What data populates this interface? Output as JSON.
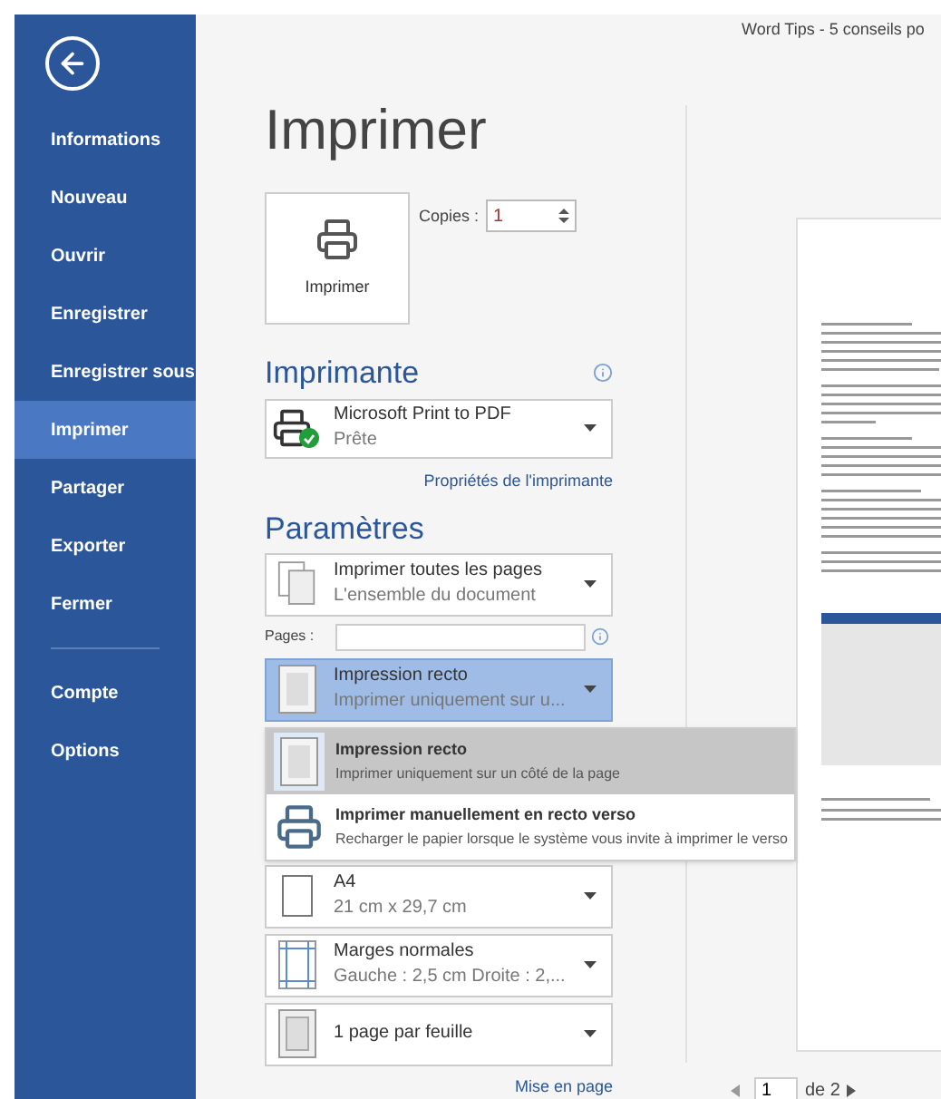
{
  "window": {
    "title": "Word Tips - 5 conseils po"
  },
  "sidebar": {
    "items": [
      {
        "label": "Informations",
        "selected": false
      },
      {
        "label": "Nouveau",
        "selected": false
      },
      {
        "label": "Ouvrir",
        "selected": false
      },
      {
        "label": "Enregistrer",
        "selected": false
      },
      {
        "label": "Enregistrer sous",
        "selected": false
      },
      {
        "label": "Imprimer",
        "selected": true
      },
      {
        "label": "Partager",
        "selected": false
      },
      {
        "label": "Exporter",
        "selected": false
      },
      {
        "label": "Fermer",
        "selected": false
      }
    ],
    "bottom_items": [
      {
        "label": "Compte",
        "selected": false
      },
      {
        "label": "Options",
        "selected": false
      }
    ]
  },
  "page_title": "Imprimer",
  "print_button": {
    "label": "Imprimer"
  },
  "copies": {
    "label": "Copies :",
    "value": "1"
  },
  "printer": {
    "heading": "Imprimante",
    "name": "Microsoft Print to PDF",
    "status": "Prête",
    "properties_link": "Propriétés de l'imprimante"
  },
  "settings": {
    "heading": "Paramètres",
    "pages_label": "Pages :",
    "dropdowns": [
      {
        "kind": "pages",
        "title": "Imprimer toutes les pages",
        "subtitle": "L'ensemble du document",
        "expanded": false
      },
      {
        "kind": "sides",
        "title": "Impression recto",
        "subtitle": "Imprimer uniquement sur u...",
        "expanded": true
      },
      {
        "kind": "paper",
        "title": "A4",
        "subtitle": "21 cm x 29,7 cm",
        "expanded": false
      },
      {
        "kind": "margins",
        "title": "Marges normales",
        "subtitle": "Gauche : 2,5 cm   Droite : 2,...",
        "expanded": false
      },
      {
        "kind": "persheet",
        "title": "1 page par feuille",
        "expanded": false
      }
    ],
    "menu": [
      {
        "kind": "sides",
        "title": "Impression recto",
        "subtitle": "Imprimer uniquement sur un côté de la page",
        "selected": true
      },
      {
        "kind": "manual",
        "title": "Imprimer manuellement en recto verso",
        "subtitle": "Recharger le papier lorsque le système vous invite à imprimer le verso",
        "selected": false
      }
    ],
    "layout_link": "Mise en page"
  },
  "preview": {
    "page_field": "1",
    "page_count": "de 2"
  }
}
